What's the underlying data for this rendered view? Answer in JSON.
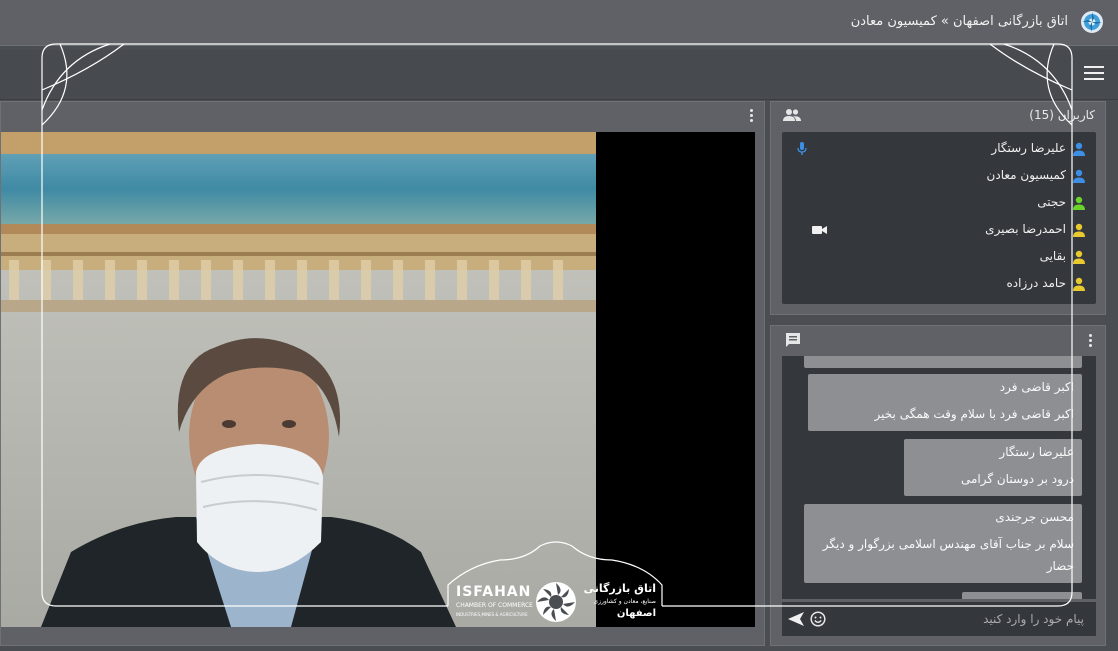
{
  "app": {
    "title": "اتاق بازرگانی اصفهان » کمیسیون معادن"
  },
  "users": {
    "header": "کاربران (15)",
    "list": [
      {
        "name": "علیرضا رستگار",
        "color": "#3d8fe6",
        "status": "mic"
      },
      {
        "name": "کمیسیون معادن",
        "color": "#3d8fe6",
        "status": ""
      },
      {
        "name": "حجتی",
        "color": "#6ad42a",
        "status": ""
      },
      {
        "name": "احمدرضا بصیری",
        "color": "#e8c930",
        "status": "camera"
      },
      {
        "name": "بقایی",
        "color": "#e8c930",
        "status": ""
      },
      {
        "name": "حامد درزاده",
        "color": "#e8c930",
        "status": ""
      }
    ]
  },
  "chat": {
    "messages": [
      {
        "sender": "اکبر قاضی فرد",
        "text": "اکبر قاضی فرد با سلام  وقت همگی بخیر"
      },
      {
        "sender": "علیرضا رستگار",
        "text": "درود بر دوستان گرامی"
      },
      {
        "sender": "محسن جرجندی",
        "text": "سلام بر جناب آقای مهندس اسلامی بزرگوار و دیگر حضار"
      }
    ],
    "input_placeholder": "پیام خود را وارد کنید"
  },
  "branding": {
    "en_name": "ISFAHAN",
    "en_sub": "CHAMBER OF COMMERCE",
    "en_sub2": "INDUSTRIES,MINES & AGRICULTURE",
    "fa_name": "اتاق بازرگانی",
    "fa_sub": "صنایع، معادن و کشاورزی",
    "fa_city": "اصفهان"
  },
  "colors": {
    "mic_icon": "#3d8fe6",
    "panel_bg": "#5f6166",
    "list_bg": "#34373b"
  }
}
